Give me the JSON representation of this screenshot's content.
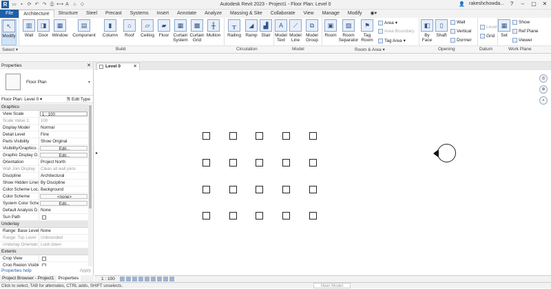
{
  "titlebar": {
    "app_icon": "R",
    "title": "Autodesk Revit 2023 - Project1 - Floor Plan: Level 0",
    "user": "rakeshchowda...",
    "qat_icons": [
      "open-icon",
      "save-icon",
      "sync-icon",
      "undo-icon",
      "redo-icon",
      "print-icon",
      "measure-icon",
      "text-icon",
      "3d-icon",
      "section-icon"
    ]
  },
  "tabs": [
    "File",
    "Architecture",
    "Structure",
    "Steel",
    "Precast",
    "Systems",
    "Insert",
    "Annotate",
    "Analyze",
    "Massing & Site",
    "Collaborate",
    "View",
    "Manage",
    "Modify"
  ],
  "active_tab": "Architecture",
  "ribbon": {
    "modify": "Modify",
    "build": [
      "Wall",
      "Door",
      "Window",
      "Component",
      "Column",
      "Roof",
      "Ceiling",
      "Floor",
      "Curtain System",
      "Curtain Grid",
      "Mullion"
    ],
    "circulation": [
      "Railing",
      "Ramp",
      "Stair"
    ],
    "model": [
      "Model Text",
      "Model Line",
      "Model Group"
    ],
    "room": [
      "Room",
      "Room Separator",
      "Tag Room"
    ],
    "room_small": [
      "Area",
      "Area Boundary",
      "Tag Area"
    ],
    "opening": [
      "By Face",
      "Shaft"
    ],
    "opening_small": [
      "Wall",
      "Vertical",
      "Dormer"
    ],
    "datum": [
      "Level",
      "Grid"
    ],
    "workplane_set": "Set",
    "workplane_small": [
      "Show",
      "Ref Plane",
      "Viewer"
    ],
    "panels": [
      "Select",
      "Build",
      "Circulation",
      "Model",
      "Room & Area",
      "Opening",
      "Datum",
      "Work Plane"
    ]
  },
  "properties": {
    "header": "Properties",
    "type_name": "Floor Plan",
    "instance": "Floor Plan: Level 0",
    "edit_type": "Edit Type",
    "rows": [
      {
        "cat": "Graphics"
      },
      {
        "k": "View Scale",
        "v": "1 : 100",
        "style": "box"
      },
      {
        "k": "Scale Value    1:",
        "v": "100",
        "dim": true
      },
      {
        "k": "Display Model",
        "v": "Normal"
      },
      {
        "k": "Detail Level",
        "v": "Fine"
      },
      {
        "k": "Parts Visibility",
        "v": "Show Original"
      },
      {
        "k": "Visibility/Graphics ...",
        "v": "Edit...",
        "style": "btn"
      },
      {
        "k": "Graphic Display O...",
        "v": "Edit...",
        "style": "btn"
      },
      {
        "k": "Orientation",
        "v": "Project North"
      },
      {
        "k": "Wall Join Display",
        "v": "Clean all wall joins",
        "dim": true
      },
      {
        "k": "Discipline",
        "v": "Architectural"
      },
      {
        "k": "Show Hidden Lines",
        "v": "By Discipline"
      },
      {
        "k": "Color Scheme Loc...",
        "v": "Background"
      },
      {
        "k": "Color Scheme",
        "v": "<none>",
        "style": "btn"
      },
      {
        "k": "System Color Sche...",
        "v": "Edit...",
        "style": "btn"
      },
      {
        "k": "Default Analysis D...",
        "v": "None"
      },
      {
        "k": "Sun Path",
        "v": "",
        "style": "chk"
      },
      {
        "cat": "Underlay"
      },
      {
        "k": "Range: Base Level",
        "v": "None"
      },
      {
        "k": "Range: Top Level",
        "v": "Unbounded",
        "dim": true
      },
      {
        "k": "Underlay Orientati...",
        "v": "Look down",
        "dim": true
      },
      {
        "cat": "Extents"
      },
      {
        "k": "Crop View",
        "v": "",
        "style": "chk"
      },
      {
        "k": "Crop Region Visible",
        "v": "",
        "style": "chk"
      }
    ],
    "help": "Properties help",
    "apply": "Apply"
  },
  "bottom_tabs": [
    "Project Browser - Project1",
    "Properties"
  ],
  "view_tab": "Level 0",
  "view_scale": "1 : 100",
  "status": {
    "message": "Click to select, TAB for alternates, CTRL adds, SHIFT unselects.",
    "model": "Main Model"
  },
  "colors": {
    "accent": "#1f5fa9"
  }
}
